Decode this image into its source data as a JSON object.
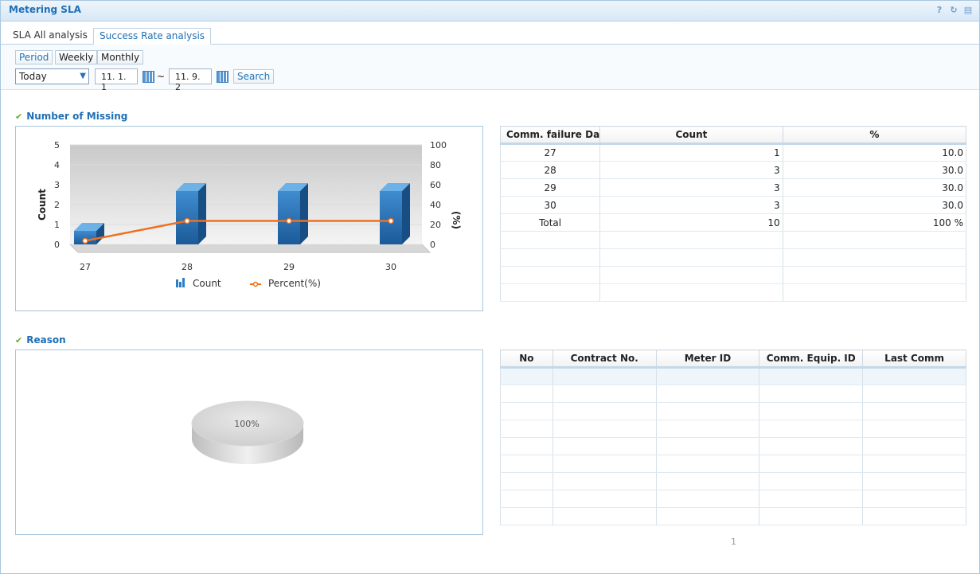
{
  "window": {
    "title": "Metering SLA"
  },
  "tabs": [
    {
      "label": "SLA All analysis"
    },
    {
      "label": "Success Rate analysis"
    }
  ],
  "filters": {
    "period_buttons": [
      "Period",
      "Weekly",
      "Monthly"
    ],
    "range_select": "Today",
    "start_date": "11. 1. 1",
    "separator": "~",
    "end_date": "11. 9. 2",
    "search_label": "Search"
  },
  "missing_section": {
    "title": "Number of Missing"
  },
  "reason_section": {
    "title": "Reason"
  },
  "chart_data": [
    {
      "type": "bar",
      "categories": [
        "27",
        "28",
        "29",
        "30"
      ],
      "series": [
        {
          "name": "Count",
          "type": "bar",
          "values": [
            1,
            3,
            3,
            3
          ],
          "axis": "left"
        },
        {
          "name": "Percent(%)",
          "type": "line",
          "values": [
            10,
            30,
            30,
            30
          ],
          "axis": "right"
        }
      ],
      "ylabel": "Count",
      "y2label": "(%)",
      "ylim": [
        0,
        5
      ],
      "y2lim": [
        0,
        100
      ],
      "yticks": [
        "0",
        "1",
        "2",
        "3",
        "4",
        "5"
      ],
      "y2ticks": [
        "0",
        "20",
        "40",
        "60",
        "80",
        "100"
      ],
      "colors": {
        "bar": "#2f7fc4",
        "line": "#f07020"
      }
    },
    {
      "type": "pie",
      "values": [
        100
      ],
      "labels": [
        "100%"
      ]
    }
  ],
  "missing_table": {
    "headers": [
      "Comm. failure Da",
      "Count",
      "%"
    ],
    "rows": [
      [
        "27",
        "1",
        "10.0"
      ],
      [
        "28",
        "3",
        "30.0"
      ],
      [
        "29",
        "3",
        "30.0"
      ],
      [
        "30",
        "3",
        "30.0"
      ],
      [
        "Total",
        "10",
        "100 %"
      ]
    ],
    "empty_rows": 4
  },
  "reason_table": {
    "headers": [
      "No",
      "Contract No.",
      "Meter ID",
      "Comm. Equip. ID",
      "Last Comm"
    ],
    "empty_rows": 9
  },
  "pager": {
    "page": "1"
  }
}
